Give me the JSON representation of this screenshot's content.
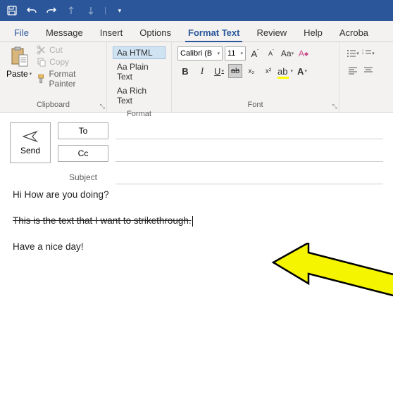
{
  "qat": {
    "save": "save",
    "undo": "undo",
    "redo": "redo"
  },
  "tabs": {
    "file": "File",
    "message": "Message",
    "insert": "Insert",
    "options": "Options",
    "format_text": "Format Text",
    "review": "Review",
    "help": "Help",
    "acrobat": "Acroba"
  },
  "clipboard": {
    "paste": "Paste",
    "cut": "Cut",
    "copy": "Copy",
    "format_painter": "Format Painter",
    "label": "Clipboard"
  },
  "format": {
    "html": "Aa HTML",
    "plain": "Aa Plain Text",
    "rich": "Aa Rich Text",
    "label": "Format"
  },
  "font": {
    "name": "Calibri (B",
    "size": "11",
    "grow": "A",
    "shrink": "A",
    "case": "Aa",
    "clear": "A",
    "bold": "B",
    "italic": "I",
    "underline": "U",
    "strike": "ab",
    "sub": "x₂",
    "sup": "x²",
    "highlight": "A",
    "color": "A",
    "label": "Font"
  },
  "compose": {
    "send": "Send",
    "to": "To",
    "cc": "Cc",
    "subject": "Subject"
  },
  "body": {
    "line1": "Hi How are you doing?",
    "line2": "This is the text that I want to strikethrough.",
    "line3": "Have a nice day!"
  }
}
